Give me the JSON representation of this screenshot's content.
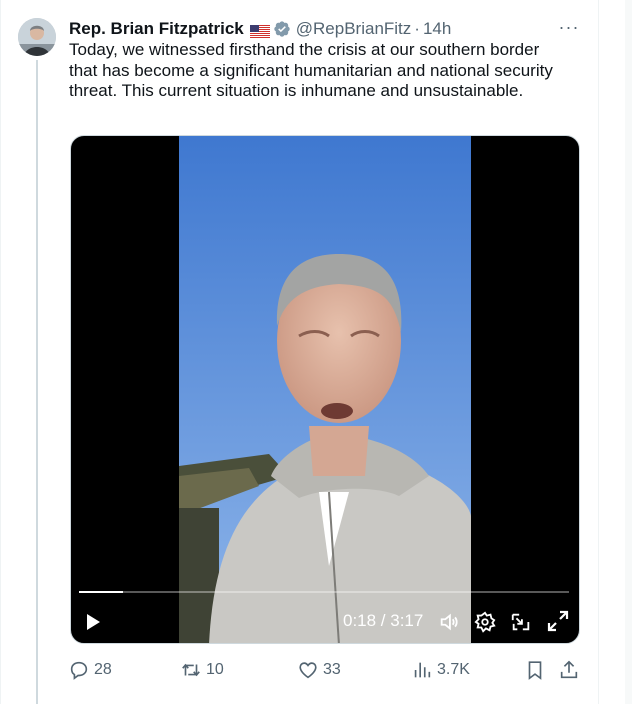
{
  "tweet": {
    "author_name": "Rep. Brian Fitzpatrick",
    "handle": "@RepBrianFitz",
    "separator": "·",
    "time": "14h",
    "more": "···",
    "text": "Today, we witnessed firsthand the crisis at our southern border that has become a significant humanitarian and national security threat. This current situation is inhumane and unsustainable."
  },
  "video": {
    "current_time": "0:18",
    "duration": "3:17",
    "timecode": "0:18 / 3:17",
    "progress": 0.09
  },
  "actions": {
    "replies": "28",
    "retweets": "10",
    "likes": "33",
    "views": "3.7K"
  },
  "colors": {
    "verified": "#829aab",
    "text_secondary": "#536471",
    "sky": "#4f86d6"
  },
  "icons": [
    "flag-icon",
    "verified-icon",
    "more-icon",
    "play-icon",
    "volume-icon",
    "settings-icon",
    "pip-icon",
    "fullscreen-icon",
    "reply-icon",
    "retweet-icon",
    "like-icon",
    "views-icon",
    "bookmark-icon",
    "share-icon"
  ]
}
